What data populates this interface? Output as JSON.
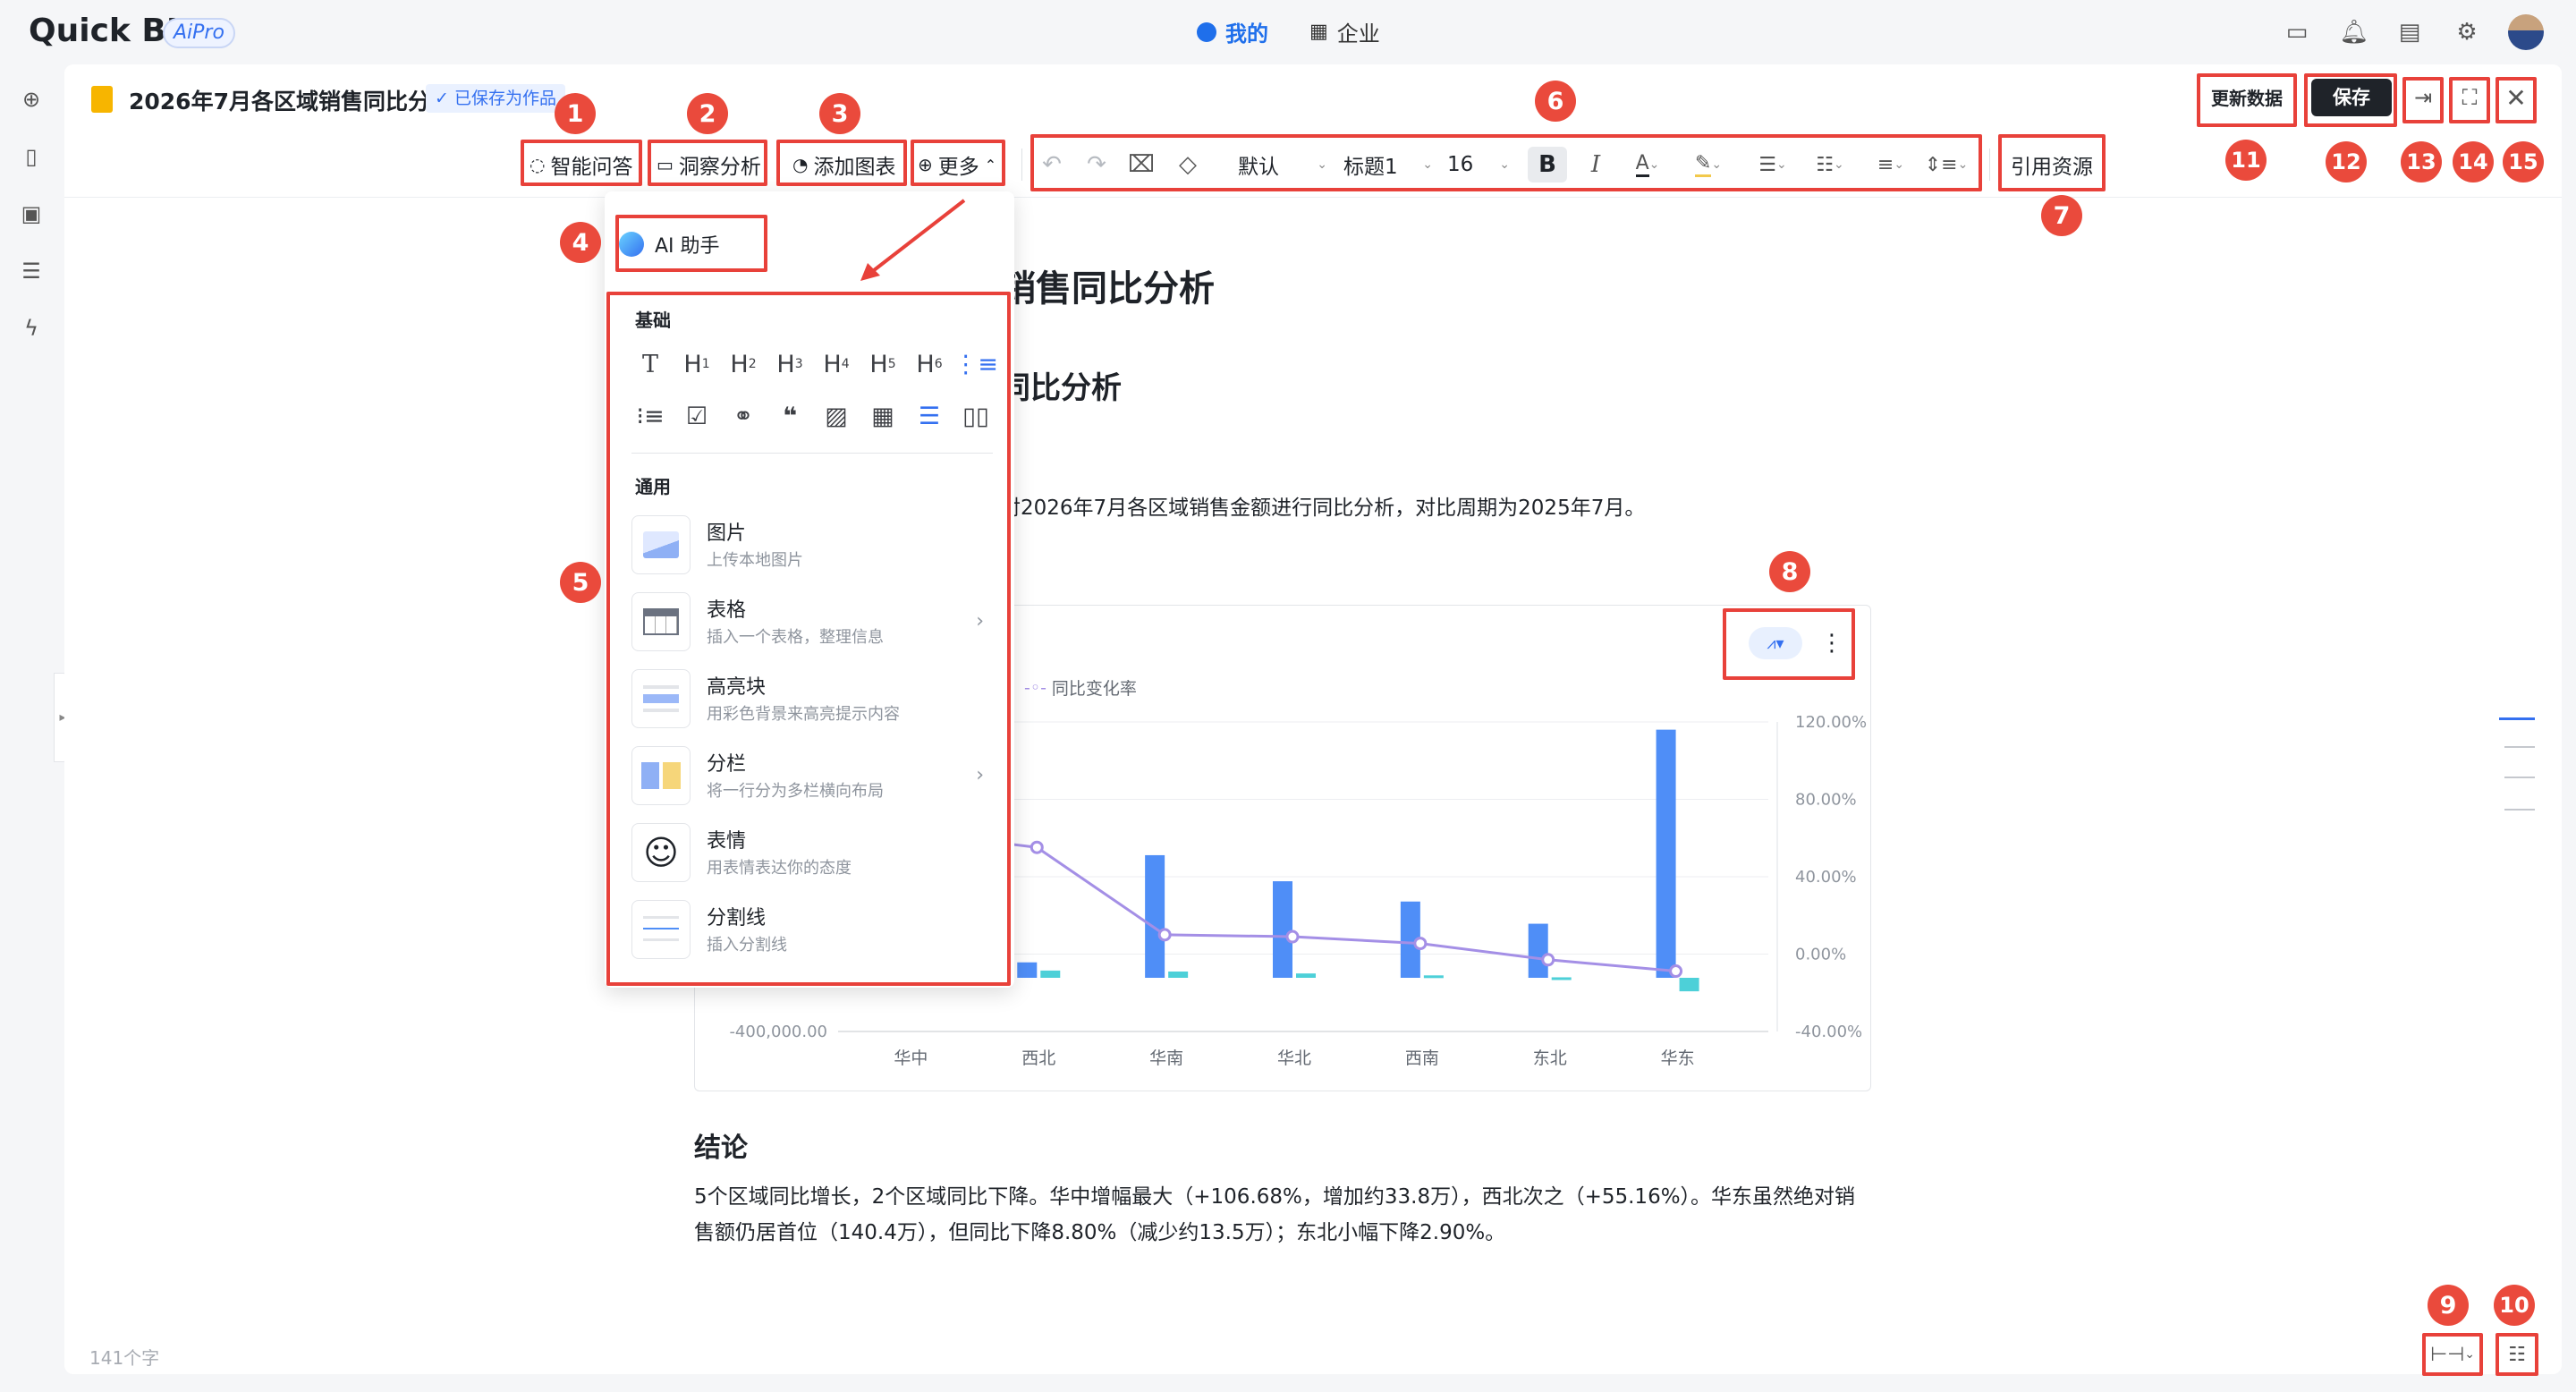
{
  "app": {
    "logo": "Quick BI",
    "pro": "AiPro",
    "nav_mine": "我的",
    "nav_enterprise": "企业"
  },
  "doc": {
    "title": "2026年7月各区域销售同比分析",
    "saved": "✓ 已保存为作品",
    "word_count": "141个字"
  },
  "actions": {
    "refresh": "更新数据",
    "save": "保存"
  },
  "toolbar": {
    "qa": "智能问答",
    "insight": "洞察分析",
    "add_chart": "添加图表",
    "more": "更多",
    "font": "默认",
    "heading": "标题1",
    "size": "16",
    "cite": "引用资源"
  },
  "menu": {
    "ai": "AI 助手",
    "basic": "基础",
    "general": "通用",
    "items": [
      {
        "title": "图片",
        "sub": "上传本地图片"
      },
      {
        "title": "表格",
        "sub": "插入一个表格，整理信息"
      },
      {
        "title": "高亮块",
        "sub": "用彩色背景来高亮提示内容"
      },
      {
        "title": "分栏",
        "sub": "将一行分为多栏横向布局"
      },
      {
        "title": "表情",
        "sub": "用表情表达你的态度"
      },
      {
        "title": "分割线",
        "sub": "插入分割线"
      }
    ]
  },
  "content": {
    "h1": "销售同比分析",
    "h2": "同比分析",
    "intro": "对2026年7月各区域销售金额进行同比分析，对比周期为2025年7月。",
    "conclusion_title": "结论",
    "conclusion_1": "5个区域同比增长，2个区域同比下降。华中增幅最大（+106.68%，增加约33.8万），西北次之（+55.16%）。华东虽然绝对销",
    "conclusion_2": "售额仍居首位（140.4万），但同比下降8.80%（减少约13.5万）；东北小幅下降2.90%。"
  },
  "annotations": [
    "1",
    "2",
    "3",
    "4",
    "5",
    "6",
    "7",
    "8",
    "9",
    "10",
    "11",
    "12",
    "13",
    "14",
    "15"
  ],
  "chart_data": {
    "type": "bar",
    "categories": [
      "华中",
      "西北",
      "华南",
      "华北",
      "西南",
      "东北",
      "华东"
    ],
    "legend": "同比变化率",
    "series": [
      {
        "name": "",
        "values": [
          null,
          160000,
          1270000,
          1000000,
          790000,
          560000,
          2570000
        ]
      },
      {
        "name": "",
        "values": [
          null,
          75000,
          65000,
          45000,
          25000,
          5000,
          -140000
        ]
      },
      {
        "name": "同比变化率",
        "values": [
          null,
          55.16,
          10,
          9,
          5.5,
          -2.9,
          -8.8
        ]
      }
    ],
    "left_tick_label": "-400,000.00",
    "right_ticks": [
      "120.00%",
      "80.00%",
      "40.00%",
      "0.00%",
      "-40.00%"
    ],
    "colors": {
      "bar1": "#4f8ef7",
      "bar2": "#4dd0d8",
      "line": "#a48fe6"
    }
  }
}
